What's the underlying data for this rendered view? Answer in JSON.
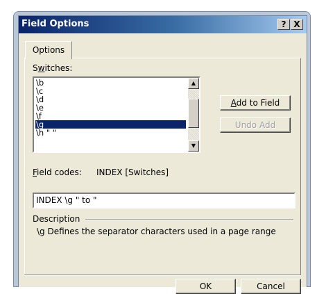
{
  "window": {
    "title": "Field Options",
    "help_btn": "?",
    "close_btn": "X"
  },
  "tabs": [
    {
      "label": "Options"
    }
  ],
  "switches": {
    "label_pre": "S",
    "label_ul": "w",
    "label_post": "itches:",
    "items": [
      "\\b",
      "\\c",
      "\\d",
      "\\e",
      "\\f",
      "\\g",
      "\\h \" \""
    ],
    "selected_index": 5
  },
  "buttons": {
    "add_pre": "",
    "add_ul": "A",
    "add_post": "dd to Field",
    "undo": "Undo Add",
    "ok": "OK",
    "cancel": "Cancel"
  },
  "field_codes": {
    "label_ul": "F",
    "label_post": "ield codes:",
    "value": "INDEX [Switches]"
  },
  "input": {
    "value": "INDEX \\g \" to \""
  },
  "description": {
    "label": "Description",
    "text": "\\g Defines the separator characters used in a page range"
  }
}
